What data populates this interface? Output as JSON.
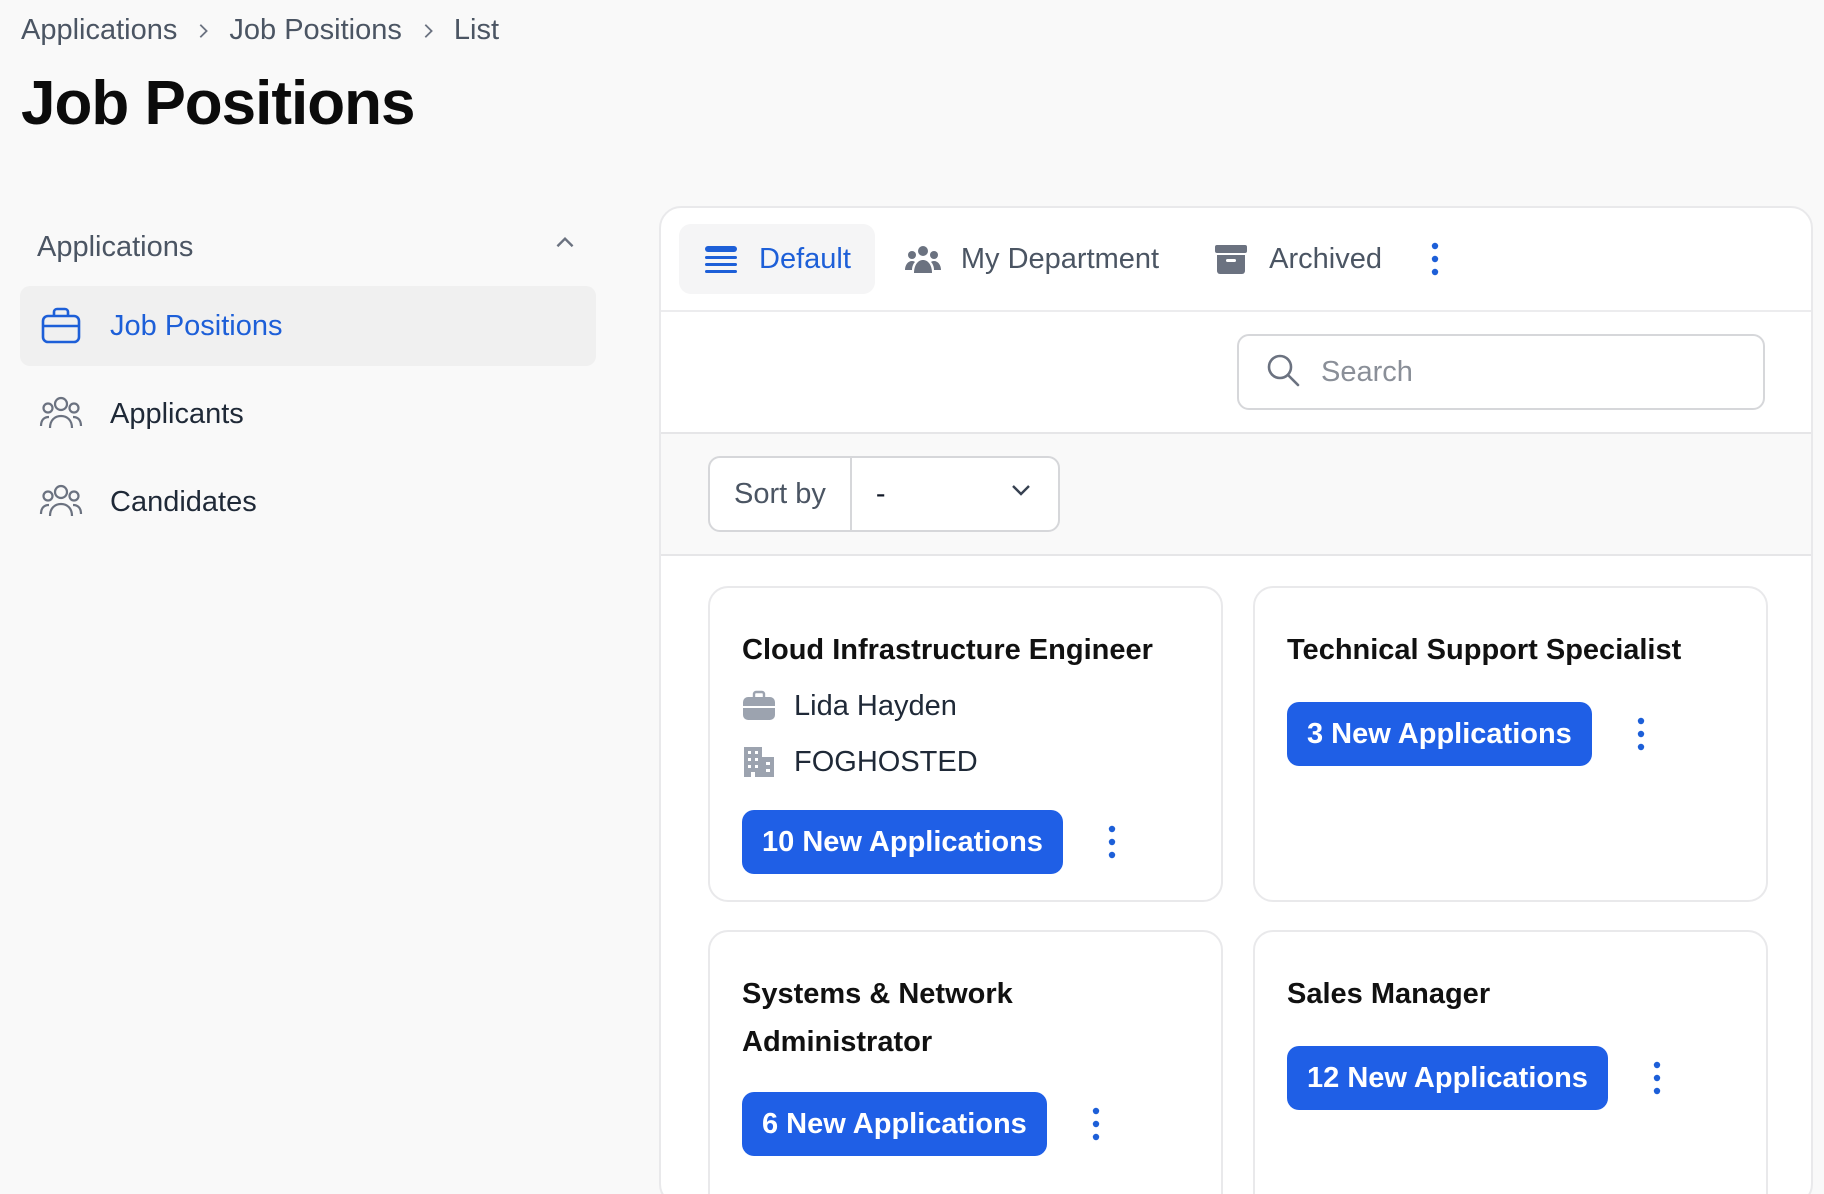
{
  "breadcrumb": [
    "Applications",
    "Job Positions",
    "List"
  ],
  "page_title": "Job Positions",
  "sidebar": {
    "group_label": "Applications",
    "items": [
      {
        "label": "Job Positions",
        "icon": "briefcase-icon",
        "active": true
      },
      {
        "label": "Applicants",
        "icon": "users-icon",
        "active": false
      },
      {
        "label": "Candidates",
        "icon": "users-icon",
        "active": false
      }
    ]
  },
  "tabs": [
    {
      "label": "Default",
      "icon": "list-icon",
      "active": true
    },
    {
      "label": "My Department",
      "icon": "group-icon",
      "active": false
    },
    {
      "label": "Archived",
      "icon": "archive-icon",
      "active": false
    }
  ],
  "search": {
    "placeholder": "Search",
    "value": ""
  },
  "sort": {
    "label": "Sort by",
    "value": "-"
  },
  "cards": [
    {
      "title": "Cloud Infrastructure Engineer",
      "recruiter": "Lida Hayden",
      "company": "FOGHOSTED",
      "button": "10 New Applications"
    },
    {
      "title": "Technical Support Specialist",
      "button": "3 New Applications"
    },
    {
      "title": "Systems & Network Administrator",
      "button": "6 New Applications"
    },
    {
      "title": "Sales Manager",
      "button": "12 New Applications"
    }
  ],
  "colors": {
    "accent": "#1f5fe6",
    "active_text": "#1d5fd8"
  }
}
